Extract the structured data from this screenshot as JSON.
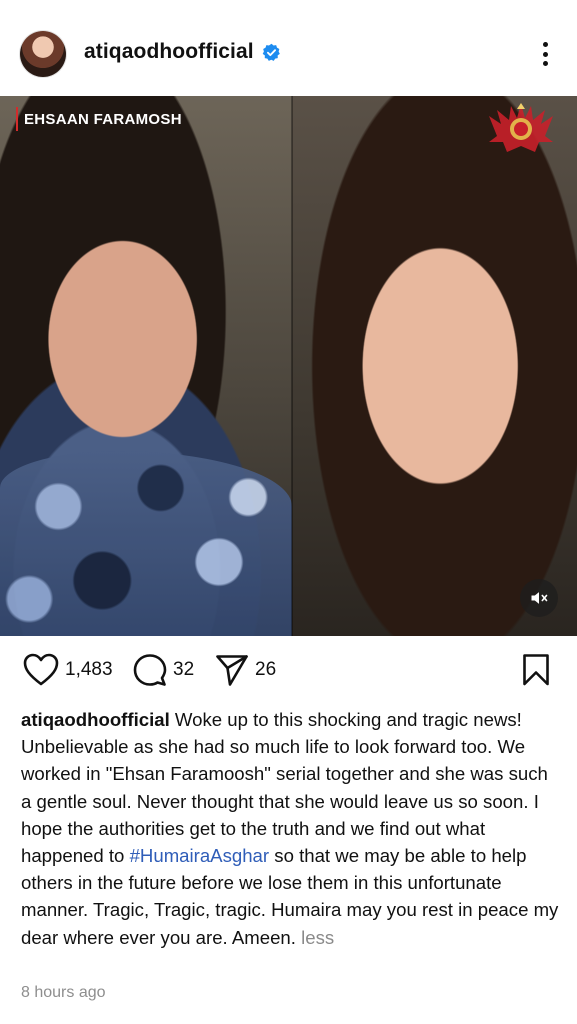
{
  "post": {
    "username": "atiqaodhoofficial",
    "verified": true,
    "more_icon": "more-vertical-icon"
  },
  "media": {
    "show_title": "EHSAAN FARAMOSH",
    "channel_logo_icon": "channel-crest-icon",
    "mute_icon": "speaker-muted-icon"
  },
  "actions": {
    "likes": "1,483",
    "comments": "32",
    "shares": "26",
    "like_icon": "heart-icon",
    "comment_icon": "comment-bubble-icon",
    "share_icon": "send-icon",
    "save_icon": "bookmark-icon"
  },
  "caption": {
    "username": "atiqaodhoofficial",
    "text_before_hashtag": "Woke up to this shocking and tragic news! Unbelievable as she had so much life to look forward too. We worked in \"Ehsan Faramoosh\" serial together and she was such a gentle soul. Never thought that she would leave us so soon. I hope the authorities get to the truth and we find out what happened to",
    "hashtag": "#HumairaAsghar",
    "text_after_hashtag": "so that we may be able to help others in the future before we lose them in this unfortunate manner. Tragic, Tragic, tragic.  Humaira may you rest in peace my dear where ever you are. Ameen.",
    "less_label": "less"
  },
  "timestamp": "8 hours ago",
  "colors": {
    "verified_blue": "#1d8cf0",
    "hashtag_blue": "#2f5db8",
    "muted_gray": "#8e8e8e",
    "title_accent_red": "#d22c2c"
  }
}
